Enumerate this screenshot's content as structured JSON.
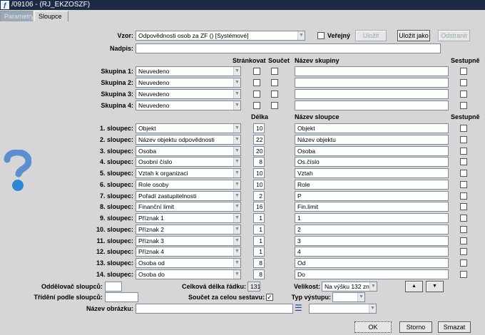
{
  "window": {
    "title": "/09106 - (RJ_EKZOSZF)",
    "icon": "app-logo-icon"
  },
  "tabs": [
    {
      "label": "Parametry"
    },
    {
      "label": "Sloupce"
    }
  ],
  "vzor": {
    "label": "Vzor:",
    "value": "Odpovědnosti osob za ZF   ()   [Systémové]"
  },
  "verejny": {
    "label": "Veřejný",
    "checked": false
  },
  "buttons": {
    "ulozit": "Uložit",
    "ulozit_jako": "Uložit jako",
    "odstranit": "Odstranit",
    "ok": "OK",
    "storno": "Storno",
    "smazat": "Smazat"
  },
  "nadpis": {
    "label": "Nadpis:",
    "value": ""
  },
  "group_headers": {
    "strankovat": "Stránkovat",
    "soucet": "Součet",
    "nazev": "Název skupiny",
    "sestupne": "Sestupně"
  },
  "groups": [
    {
      "label": "Skupina 1:",
      "value": "Neuvedeno",
      "name": ""
    },
    {
      "label": "Skupina 2:",
      "value": "Neuvedeno",
      "name": ""
    },
    {
      "label": "Skupina 3:",
      "value": "Neuvedeno",
      "name": ""
    },
    {
      "label": "Skupina 4:",
      "value": "Neuvedeno",
      "name": ""
    }
  ],
  "column_headers": {
    "delka": "Délka",
    "nazev": "Název sloupce",
    "sestupne": "Sestupně"
  },
  "columns": [
    {
      "label": "1. sloupec:",
      "value": "Objekt",
      "length": "10",
      "name": "Objekt"
    },
    {
      "label": "2. sloupec:",
      "value": "Název objektu odpovědnosti",
      "length": "22",
      "name": "Název objektu"
    },
    {
      "label": "3. sloupec:",
      "value": "Osoba",
      "length": "20",
      "name": "Osoba"
    },
    {
      "label": "4. sloupec:",
      "value": "Osobní číslo",
      "length": "8",
      "name": "Os.číslo"
    },
    {
      "label": "5. sloupec:",
      "value": "Vztah k organizaci",
      "length": "10",
      "name": "Vztah"
    },
    {
      "label": "6. sloupec:",
      "value": "Role osoby",
      "length": "10",
      "name": "Role"
    },
    {
      "label": "7. sloupec:",
      "value": "Pořadí zastupitelnosti",
      "length": "2",
      "name": "P"
    },
    {
      "label": "8. sloupec:",
      "value": "Finanční limit",
      "length": "16",
      "name": "Fin.limit"
    },
    {
      "label": "9. sloupec:",
      "value": "Příznak 1",
      "length": "1",
      "name": "1"
    },
    {
      "label": "10. sloupec:",
      "value": "Příznak 2",
      "length": "1",
      "name": "2"
    },
    {
      "label": "11. sloupec:",
      "value": "Příznak 3",
      "length": "1",
      "name": "3"
    },
    {
      "label": "12. sloupec:",
      "value": "Příznak 4",
      "length": "1",
      "name": "4"
    },
    {
      "label": "13. sloupec:",
      "value": "Osoba od",
      "length": "8",
      "name": "Od"
    },
    {
      "label": "14. sloupec:",
      "value": "Osoba do",
      "length": "8",
      "name": "Do"
    }
  ],
  "bottom": {
    "oddelovac_label": "Oddělovač sloupců:",
    "oddelovac_value": "",
    "celkova_label": "Celková délka řádku:",
    "celkova_value": "131",
    "velikost_label": "Velikost:",
    "velikost_value": "Na výšku 132 zn.",
    "trideni_label": "Třídění podle sloupců:",
    "trideni_value": "",
    "soucet_label": "Součet za celou sestavu:",
    "soucet_checked": true,
    "typ_label": "Typ výstupu:",
    "typ_value": "",
    "obrazek_label": "Název obrázku:",
    "obrazek_value": "",
    "obrazek_select": ""
  }
}
